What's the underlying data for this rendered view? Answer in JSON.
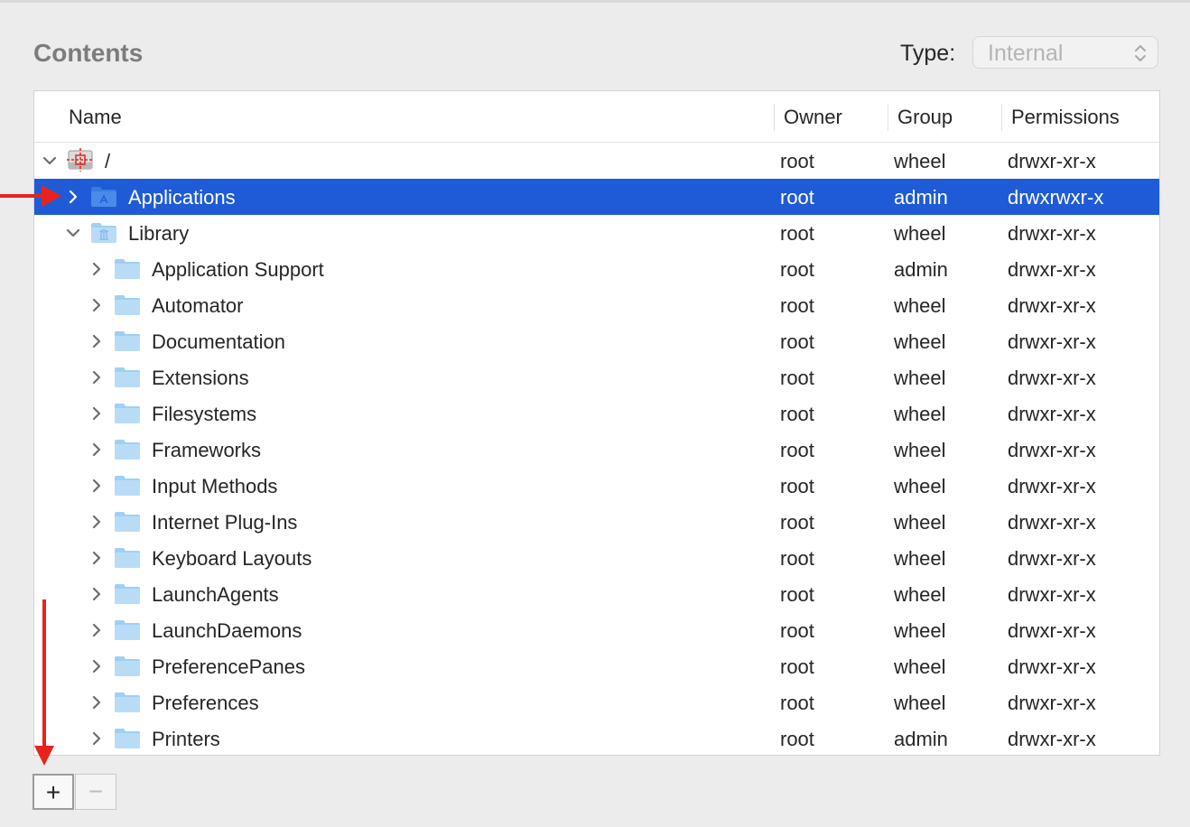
{
  "section_title": "Contents",
  "type_filter": {
    "label": "Type:",
    "value": "Internal"
  },
  "columns": {
    "name": "Name",
    "owner": "Owner",
    "group": "Group",
    "permissions": "Permissions"
  },
  "rows": [
    {
      "name": "/",
      "owner": "root",
      "group": "wheel",
      "permissions": "drwxr-xr-x",
      "depth": 0,
      "expanded": true,
      "icon": "disk-icon",
      "selected": false
    },
    {
      "name": "Applications",
      "owner": "root",
      "group": "admin",
      "permissions": "drwxrwxr-x",
      "depth": 1,
      "expanded": false,
      "icon": "applications-folder-icon",
      "selected": true
    },
    {
      "name": "Library",
      "owner": "root",
      "group": "wheel",
      "permissions": "drwxr-xr-x",
      "depth": 1,
      "expanded": true,
      "icon": "library-folder-icon",
      "selected": false
    },
    {
      "name": "Application Support",
      "owner": "root",
      "group": "admin",
      "permissions": "drwxr-xr-x",
      "depth": 2,
      "expanded": false,
      "icon": "folder-icon",
      "selected": false
    },
    {
      "name": "Automator",
      "owner": "root",
      "group": "wheel",
      "permissions": "drwxr-xr-x",
      "depth": 2,
      "expanded": false,
      "icon": "folder-icon",
      "selected": false
    },
    {
      "name": "Documentation",
      "owner": "root",
      "group": "wheel",
      "permissions": "drwxr-xr-x",
      "depth": 2,
      "expanded": false,
      "icon": "folder-icon",
      "selected": false
    },
    {
      "name": "Extensions",
      "owner": "root",
      "group": "wheel",
      "permissions": "drwxr-xr-x",
      "depth": 2,
      "expanded": false,
      "icon": "folder-icon",
      "selected": false
    },
    {
      "name": "Filesystems",
      "owner": "root",
      "group": "wheel",
      "permissions": "drwxr-xr-x",
      "depth": 2,
      "expanded": false,
      "icon": "folder-icon",
      "selected": false
    },
    {
      "name": "Frameworks",
      "owner": "root",
      "group": "wheel",
      "permissions": "drwxr-xr-x",
      "depth": 2,
      "expanded": false,
      "icon": "folder-icon",
      "selected": false
    },
    {
      "name": "Input Methods",
      "owner": "root",
      "group": "wheel",
      "permissions": "drwxr-xr-x",
      "depth": 2,
      "expanded": false,
      "icon": "folder-icon",
      "selected": false
    },
    {
      "name": "Internet Plug-Ins",
      "owner": "root",
      "group": "wheel",
      "permissions": "drwxr-xr-x",
      "depth": 2,
      "expanded": false,
      "icon": "folder-icon",
      "selected": false
    },
    {
      "name": "Keyboard Layouts",
      "owner": "root",
      "group": "wheel",
      "permissions": "drwxr-xr-x",
      "depth": 2,
      "expanded": false,
      "icon": "folder-icon",
      "selected": false
    },
    {
      "name": "LaunchAgents",
      "owner": "root",
      "group": "wheel",
      "permissions": "drwxr-xr-x",
      "depth": 2,
      "expanded": false,
      "icon": "folder-icon",
      "selected": false
    },
    {
      "name": "LaunchDaemons",
      "owner": "root",
      "group": "wheel",
      "permissions": "drwxr-xr-x",
      "depth": 2,
      "expanded": false,
      "icon": "folder-icon",
      "selected": false
    },
    {
      "name": "PreferencePanes",
      "owner": "root",
      "group": "wheel",
      "permissions": "drwxr-xr-x",
      "depth": 2,
      "expanded": false,
      "icon": "folder-icon",
      "selected": false
    },
    {
      "name": "Preferences",
      "owner": "root",
      "group": "wheel",
      "permissions": "drwxr-xr-x",
      "depth": 2,
      "expanded": false,
      "icon": "folder-icon",
      "selected": false
    },
    {
      "name": "Printers",
      "owner": "root",
      "group": "admin",
      "permissions": "drwxr-xr-x",
      "depth": 2,
      "expanded": false,
      "icon": "folder-icon",
      "selected": false
    }
  ],
  "buttons": {
    "add": "+",
    "remove": "−"
  },
  "colors": {
    "selection": "#1f5bd6",
    "annotation_arrow": "#e8231e",
    "folder": "#9fd0f2"
  }
}
